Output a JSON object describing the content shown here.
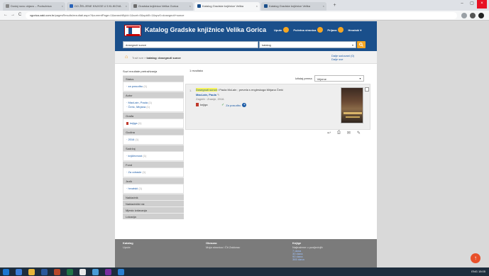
{
  "browser": {
    "tabs": [
      {
        "label": "Dodaj novu objavu – Podružnica",
        "active": false
      },
      {
        "label": "DO ŽELJENE KNJIGE U 5 KLIKOVA",
        "active": false
      },
      {
        "label": "Gradska knjižnica Velika Gorica",
        "active": false
      },
      {
        "label": "Katalog Gradske knjižnice Velika",
        "active": true
      },
      {
        "label": "Katalog Gradske knjižnice Velika",
        "active": false
      }
    ],
    "new_tab": "+",
    "url_host": "vgorica.zaki.com.hr",
    "url_path": "/pagesResults/rezultati.aspx?&currentPage=1&searchById=1&sort=0&spid0=1&spv0=dosegnuti+sunce",
    "nav_back": "←",
    "nav_forward": "→",
    "nav_reload": "C",
    "win_min": "–",
    "win_max": "▢",
    "win_close": "×"
  },
  "site": {
    "title": "Katalog Gradske knjižnice Velika Gorica",
    "nav": [
      {
        "label": "Upute"
      },
      {
        "label": "Početna stranica"
      },
      {
        "label": "Prijava"
      },
      {
        "label": "Hrvatski ▾"
      }
    ]
  },
  "search": {
    "query": "dosegnuti sunce",
    "scope": "katalog",
    "scope_caret": "▾",
    "button_icon": "magnifier-icon"
  },
  "breadcrumb": {
    "home_icon": "home-icon",
    "prefix": "Traži sve »",
    "current": "katalog: dosegnuti sunce"
  },
  "saved_links": {
    "saved": "Dalje sačuvani (0)",
    "all": "Dalje sve"
  },
  "sidebar": {
    "title": "Suzi rezultate pretraživanja",
    "facets": [
      {
        "head": "Status",
        "items": [
          {
            "label": "za posudbu",
            "count": "(1)",
            "book": false
          }
        ]
      },
      {
        "head": "Autor",
        "items": [
          {
            "label": "MacLain, Paula",
            "count": "(1)",
            "book": false
          },
          {
            "label": "Čeric, Mirjana",
            "count": "(1)",
            "book": false
          }
        ]
      },
      {
        "head": "Građa",
        "items": [
          {
            "label": "knjiga",
            "count": "(1)",
            "book": true
          }
        ]
      },
      {
        "head": "Godina",
        "items": [
          {
            "label": "2016",
            "count": "(1)",
            "book": false
          }
        ]
      },
      {
        "head": "Sadržaj",
        "items": [
          {
            "label": "književnost",
            "count": "(1)",
            "book": false
          }
        ]
      },
      {
        "head": "Fond",
        "items": [
          {
            "label": "Za odrasle",
            "count": "(1)",
            "book": false
          }
        ]
      },
      {
        "head": "Jezik",
        "items": [
          {
            "label": "hrvatski",
            "count": "(1)",
            "book": false
          }
        ]
      }
    ],
    "closed": [
      "Nakladnik",
      "Nakladnički niz",
      "Mjesto izdavanja",
      "Lokacija"
    ]
  },
  "results": {
    "count_text": "1 rezultata",
    "sort_label": "Izlistaj prema",
    "sort_value": "Vrijeme",
    "sort_caret": "▾",
    "items": [
      {
        "num": "1.",
        "title_hl": "Dosegnuti sunce",
        "title_rest": " / Paula McLain ; prevela s engleskoga Mirjana Čerić",
        "author": "MacLain, Paula",
        "author_icon": "✎",
        "publication": "Zagreb : Znanje, 2016.",
        "type": "knjiga",
        "availability": "Za posudbu",
        "availability_check": "✓",
        "availability_plus": "+"
      }
    ],
    "actions": [
      "↩",
      "⎙",
      "✉",
      "✎"
    ]
  },
  "footer": {
    "col1": {
      "head": "Katalog",
      "links": [
        "Upute"
      ]
    },
    "col2": {
      "head": "Obrazac",
      "links": [
        "Moja stranica i Čit Zaklorac"
      ]
    },
    "col3": {
      "head": "Knjige",
      "links": [
        "Najtražene u posljednjih",
        "7 dana",
        "30 dana",
        "90 dana",
        "365 dana"
      ]
    }
  },
  "taskbar": {
    "tray_text": "ENG  15:05"
  },
  "to_top_icon": "↑",
  "colors": {
    "brand_blue": "#1a4f8b",
    "accent_orange": "#f5a623",
    "link_blue": "#1a5aa6",
    "highlight_yellow": "#f6f35a",
    "footer_gray": "#7b7b7b"
  }
}
